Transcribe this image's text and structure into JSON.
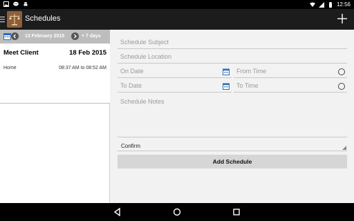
{
  "status_bar": {
    "time": "12:56",
    "icons_left": [
      "gallery-icon",
      "messenger-icon",
      "android-icon"
    ],
    "icons_right": [
      "wifi-icon",
      "signal-icon",
      "battery-icon"
    ]
  },
  "app_bar": {
    "title": "Schedules",
    "logo_icon": "scales-icon",
    "action_icon": "plus-icon"
  },
  "date_nav": {
    "date_label": "13 February 2015",
    "forward_label": "+ 7 days"
  },
  "schedules": [
    {
      "subject": "Meet Client",
      "date": "18 Feb 2015",
      "location": "Home",
      "time_range": "08:37 AM to 08:52 AM"
    }
  ],
  "form": {
    "subject_placeholder": "Schedule Subject",
    "location_placeholder": "Schedule Location",
    "on_date_placeholder": "On Date",
    "from_time_placeholder": "From Time",
    "to_date_placeholder": "To Date",
    "to_time_placeholder": "To Time",
    "notes_placeholder": "Schedule Notes",
    "confirm_value": "Confirm",
    "add_button_label": "Add Schedule"
  },
  "colors": {
    "app_bar": "#1c1c1c",
    "date_bar": "#bdbdbd",
    "button": "#d6d6d6",
    "background": "#f2f2f2"
  }
}
